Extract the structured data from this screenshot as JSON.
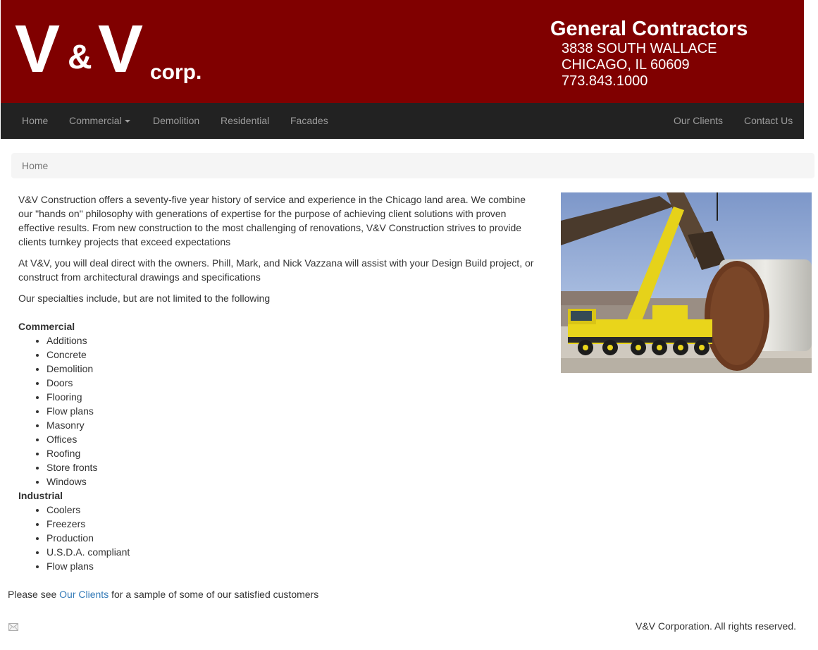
{
  "header": {
    "logo_big_1": "V",
    "logo_amp": "&",
    "logo_big_2": "V",
    "logo_corp": "corp.",
    "title": "General Contractors",
    "address_line1": "3838 SOUTH WALLACE",
    "address_line2": "CHICAGO, IL 60609",
    "phone": "773.843.1000",
    "banner_color": "#800000"
  },
  "nav": {
    "home": "Home",
    "commercial": "Commercial",
    "demolition": "Demolition",
    "residential": "Residential",
    "facades": "Facades",
    "our_clients": "Our Clients",
    "contact_us": "Contact Us"
  },
  "breadcrumb": {
    "current": "Home"
  },
  "main": {
    "paragraph1": "V&V Construction offers a seventy-five year history of service and experience in the Chicago land area. We combine our \"hands on\" philosophy with generations of expertise for the purpose of achieving client solutions with proven effective results. From new construction to the most challenging of renovations, V&V Construction strives to provide clients turnkey projects that exceed expectations",
    "paragraph2": "At V&V, you will deal direct with the owners. Phill, Mark, and Nick Vazzana will assist with your Design Build project, or construct from architectural drawings and specifications",
    "paragraph3": "Our specialties include, but are not limited to the following",
    "commercial_heading": "Commercial",
    "commercial_items": [
      "Additions",
      "Concrete",
      "Demolition",
      "Doors",
      "Flooring",
      "Flow plans",
      "Masonry",
      "Offices",
      "Roofing",
      "Store fronts",
      "Windows"
    ],
    "industrial_heading": "Industrial",
    "industrial_items": [
      "Coolers",
      "Freezers",
      "Production",
      "U.S.D.A. compliant",
      "Flow plans"
    ]
  },
  "clients_line": {
    "prefix": "Please see ",
    "link": "Our Clients",
    "suffix": " for a sample of some of our satisfied customers"
  },
  "footer": {
    "copyright": "V&V Corporation. All rights reserved.",
    "mail_icon": "envelope-icon"
  },
  "link_color": "#337ab7",
  "navbar_color": "#222222"
}
